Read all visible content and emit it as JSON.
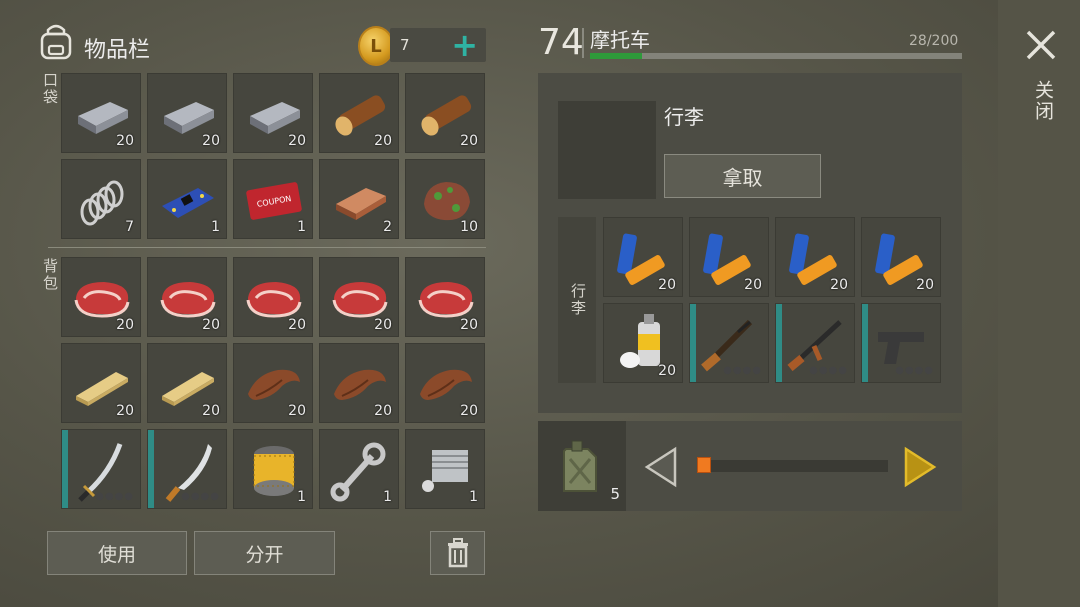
{
  "inventory": {
    "title": "物品栏",
    "coin_symbol": "L",
    "coin_count": "7",
    "add_symbol": "+"
  },
  "sections": {
    "pocket_label": "口袋",
    "backpack_label": "背包"
  },
  "pocket": [
    {
      "icon": "iron-bar",
      "count": "20"
    },
    {
      "icon": "iron-bar",
      "count": "20"
    },
    {
      "icon": "iron-bar",
      "count": "20"
    },
    {
      "icon": "log",
      "count": "20"
    },
    {
      "icon": "log",
      "count": "20"
    },
    {
      "icon": "spring",
      "count": "7"
    },
    {
      "icon": "circuit-board",
      "count": "1"
    },
    {
      "icon": "coupon",
      "count": "1"
    },
    {
      "icon": "copper-bar",
      "count": "2"
    },
    {
      "icon": "ore-rock",
      "count": "10"
    }
  ],
  "backpack": [
    {
      "icon": "raw-meat",
      "count": "20"
    },
    {
      "icon": "raw-meat",
      "count": "20"
    },
    {
      "icon": "raw-meat",
      "count": "20"
    },
    {
      "icon": "raw-meat",
      "count": "20"
    },
    {
      "icon": "raw-meat",
      "count": "20"
    },
    {
      "icon": "wood-plank",
      "count": "20"
    },
    {
      "icon": "wood-plank",
      "count": "20"
    },
    {
      "icon": "leather",
      "count": "20"
    },
    {
      "icon": "leather",
      "count": "20"
    },
    {
      "icon": "leather",
      "count": "20"
    },
    {
      "icon": "katana",
      "count": "",
      "durability": true
    },
    {
      "icon": "machete",
      "count": "",
      "durability": true
    },
    {
      "icon": "oil-filter",
      "count": "1"
    },
    {
      "icon": "wrench",
      "count": "1"
    },
    {
      "icon": "engine-cylinder",
      "count": "1"
    }
  ],
  "actions": {
    "use_label": "使用",
    "split_label": "分开"
  },
  "vehicle": {
    "level": "74",
    "name": "摩托车",
    "capacity": "28/200",
    "capacity_fraction": 0.14
  },
  "luggage": {
    "title": "行李",
    "take_label": "拿取",
    "tag_label": "行李",
    "items": [
      {
        "icon": "batteries",
        "count": "20"
      },
      {
        "icon": "batteries",
        "count": "20"
      },
      {
        "icon": "batteries",
        "count": "20"
      },
      {
        "icon": "batteries",
        "count": "20"
      },
      {
        "icon": "spray-paint",
        "count": "20"
      },
      {
        "icon": "rifle",
        "count": "",
        "durability": true
      },
      {
        "icon": "assault-rifle",
        "count": "",
        "durability": true
      },
      {
        "icon": "pistol",
        "count": "",
        "durability": true
      }
    ]
  },
  "fuel": {
    "icon": "jerrycan",
    "count": "5",
    "level_fraction": 0.0
  },
  "close_label": "关闭",
  "colors": {
    "accent": "#2fb3a3",
    "capacity": "#2e9a3a",
    "slider": "#f07a20",
    "arrow_next": "#d9b021"
  }
}
